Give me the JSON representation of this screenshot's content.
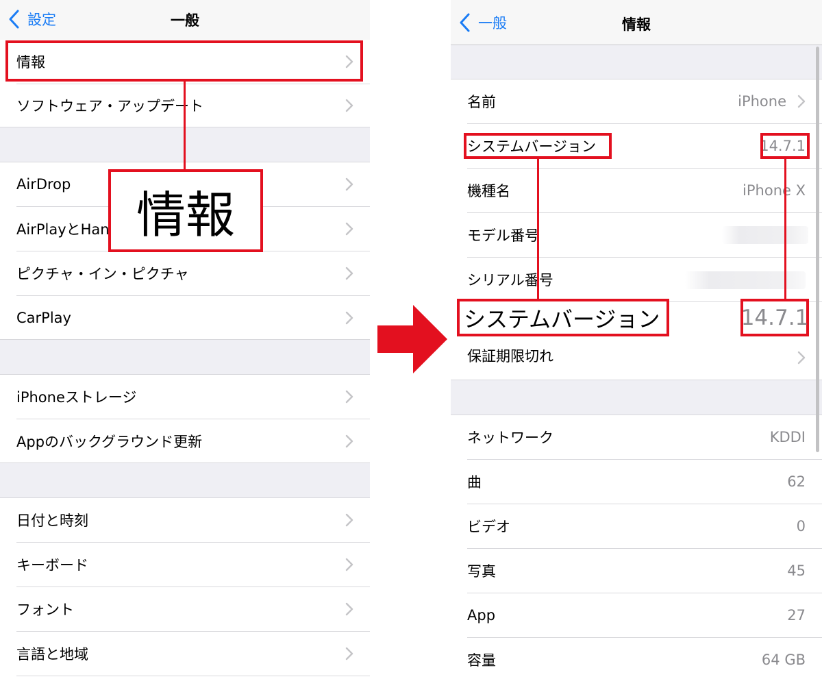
{
  "left": {
    "nav": {
      "back_label": "設定",
      "title": "一般"
    },
    "rows": [
      "情報",
      "ソフトウェア・アップデート",
      "AirDrop",
      "AirPlayとHandoff",
      "ピクチャ・イン・ピクチャ",
      "CarPlay",
      "iPhoneストレージ",
      "Appのバックグラウンド更新",
      "日付と時刻",
      "キーボード",
      "フォント",
      "言語と地域"
    ],
    "callout_label": "情報"
  },
  "right": {
    "nav": {
      "back_label": "一般",
      "title": "情報"
    },
    "rows": [
      {
        "label": "名前",
        "value": "iPhone"
      },
      {
        "label": "システムバージョン",
        "value": "14.7.1"
      },
      {
        "label": "機種名",
        "value": "iPhone X"
      },
      {
        "label": "モデル番号",
        "value": ""
      },
      {
        "label": "シリアル番号",
        "value": ""
      },
      {
        "label": "保証期限切れ",
        "value": ""
      },
      {
        "label": "ネットワーク",
        "value": "KDDI"
      },
      {
        "label": "曲",
        "value": "62"
      },
      {
        "label": "ビデオ",
        "value": "0"
      },
      {
        "label": "写真",
        "value": "45"
      },
      {
        "label": "App",
        "value": "27"
      },
      {
        "label": "容量",
        "value": "64 GB"
      }
    ],
    "callout_label": "システムバージョン",
    "callout_value": "14.7.1"
  },
  "colors": {
    "accent_blue": "#1a7cf5",
    "highlight_red": "#e3101f",
    "secondary_text": "#8a8a8e",
    "group_background": "#efeff4"
  },
  "icons": [
    "chevron-left-icon",
    "chevron-right-icon",
    "arrow-right-icon"
  ]
}
